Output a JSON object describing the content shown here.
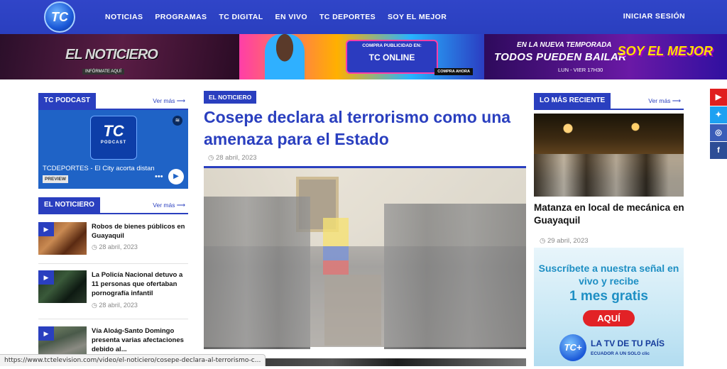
{
  "header": {
    "logo_text": "TC",
    "nav": [
      "NOTICIAS",
      "PROGRAMAS",
      "TC DIGITAL",
      "EN VIVO",
      "TC DEPORTES",
      "SOY EL MEJOR"
    ],
    "login": "INICIAR SESIÓN"
  },
  "banners": {
    "b1": {
      "title": "EL NOTICIERO",
      "sub": "INFÓRMATE AQUÍ"
    },
    "b2": {
      "line1": "COMPRA PUBLICIDAD EN:",
      "line2": "TC ONLINE",
      "button": "COMPRA AHORA"
    },
    "b3": {
      "line1": "EN LA NUEVA TEMPORADA",
      "line2": "TODOS PUEDEN BAILAR",
      "line3": "LUN - VIER 17H30",
      "badge": "SOY EL MEJOR"
    }
  },
  "podcast": {
    "section_title": "TC PODCAST",
    "ver_mas": "Ver más ⟶",
    "logo_tc": "TC",
    "logo_sub": "PODCAST",
    "episode": "TCDEPORTES - El City acorta distan",
    "preview": "PREVIEW",
    "dots": "•••"
  },
  "noticiero": {
    "section_title": "EL NOTICIERO",
    "ver_mas": "Ver más ⟶",
    "items": [
      {
        "title": "Robos de bienes públicos en Guayaquil",
        "date": "28 abril, 2023"
      },
      {
        "title": "La Policía Nacional detuvo a 11 personas que ofertaban pornografía infantil",
        "date": "28 abril, 2023"
      },
      {
        "title": "Vía Aloág-Santo Domingo presenta varias afectaciones debido al...",
        "date": ""
      }
    ]
  },
  "article": {
    "tag": "EL NOTICIERO",
    "headline": "Cosepe declara al terrorismo como una amenaza para el Estado",
    "date": "28 abril, 2023"
  },
  "recent": {
    "section_title": "LO MÁS RECIENTE",
    "ver_mas": "Ver más ⟶",
    "title": "Matanza en local de mecánica en Guayaquil",
    "date": "29 abril, 2023"
  },
  "promo": {
    "line1": "Suscríbete a nuestra señal en vivo y recibe",
    "line2": "1 mes gratis",
    "button": "AQUÍ",
    "logo": "TC+",
    "line3": "LA TV DE TU PAÍS",
    "line4": "ECUADOR A UN SOLO clic"
  },
  "social": [
    "youtube-icon",
    "twitter-icon",
    "instagram-icon",
    "facebook-icon"
  ],
  "status_url": "https://www.tctelevision.com/video/el-noticiero/cosepe-declara-al-terrorismo-c..."
}
